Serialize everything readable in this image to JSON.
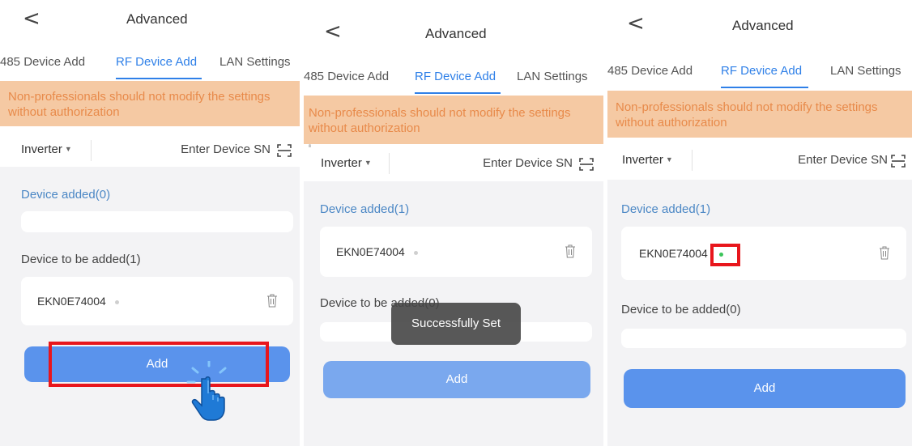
{
  "header": {
    "back_symbol": "<",
    "title": "Advanced"
  },
  "tabs": [
    "485 Device Add",
    "RF Device Add",
    "LAN Settings"
  ],
  "warning": "Non-professionals should not modify the settings without authorization",
  "filter": {
    "device_type": "Inverter",
    "sn_placeholder": "Enter Device SN"
  },
  "screens": [
    {
      "added_title": "Device added(0)",
      "to_add_title": "Device to be added(1)",
      "to_add_items": [
        {
          "sn": "EKN0E74004",
          "status_color": "#cfcfcf"
        }
      ],
      "add_label": "Add"
    },
    {
      "added_title": "Device added(1)",
      "added_items": [
        {
          "sn": "EKN0E74004",
          "status_color": "#cfcfcf"
        }
      ],
      "to_add_title": "Device to be added(0)",
      "add_label": "Add",
      "toast": "Successfully Set"
    },
    {
      "added_title": "Device added(1)",
      "added_items": [
        {
          "sn": "EKN0E74004",
          "status_color": "#3cc45a"
        }
      ],
      "to_add_title": "Device to be added(0)",
      "add_label": "Add"
    }
  ],
  "colors": {
    "accent": "#2f80e8",
    "warning_bg": "#f5c9a3",
    "warning_text": "#e88a4a",
    "button": "#5a93ec",
    "highlight": "#e8161c",
    "online": "#3cc45a"
  }
}
